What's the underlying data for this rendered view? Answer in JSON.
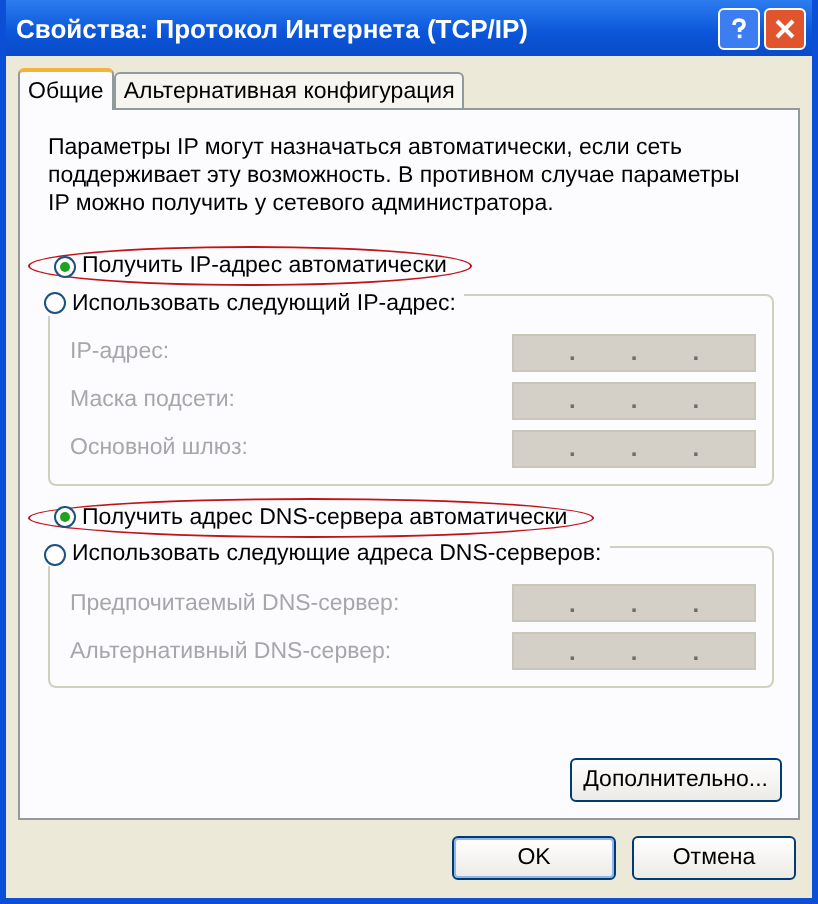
{
  "window": {
    "title": "Свойства: Протокол Интернета (TCP/IP)"
  },
  "tabs": [
    {
      "label": "Общие",
      "selected": true
    },
    {
      "label": "Альтернативная конфигурация",
      "selected": false
    }
  ],
  "description": "Параметры IP могут назначаться автоматически, если сеть поддерживает эту возможность. В противном случае параметры IP можно получить у сетевого администратора.",
  "sections": [
    {
      "radios": [
        {
          "label": "Получить IP-адрес автоматически",
          "selected": true,
          "circled": true
        },
        {
          "label": "Использовать следующий IP-адрес:",
          "selected": false,
          "circled": false
        }
      ],
      "fields": [
        {
          "label": "IP-адрес:",
          "disabled": true,
          "separators": [
            ".",
            ".",
            "."
          ]
        },
        {
          "label": "Маска подсети:",
          "disabled": true,
          "separators": [
            ".",
            ".",
            "."
          ]
        },
        {
          "label": "Основной шлюз:",
          "disabled": true,
          "separators": [
            ".",
            ".",
            "."
          ]
        }
      ]
    },
    {
      "radios": [
        {
          "label": "Получить адрес DNS-сервера автоматически",
          "selected": true,
          "circled": true
        },
        {
          "label": "Использовать следующие адреса DNS-серверов:",
          "selected": false,
          "circled": false
        }
      ],
      "fields": [
        {
          "label": "Предпочитаемый DNS-сервер:",
          "disabled": true,
          "separators": [
            ".",
            ".",
            "."
          ]
        },
        {
          "label": "Альтернативный DNS-сервер:",
          "disabled": true,
          "separators": [
            ".",
            ".",
            "."
          ]
        }
      ]
    }
  ],
  "advanced_button": "Дополнительно...",
  "buttons": [
    "OK",
    "Отмена"
  ]
}
